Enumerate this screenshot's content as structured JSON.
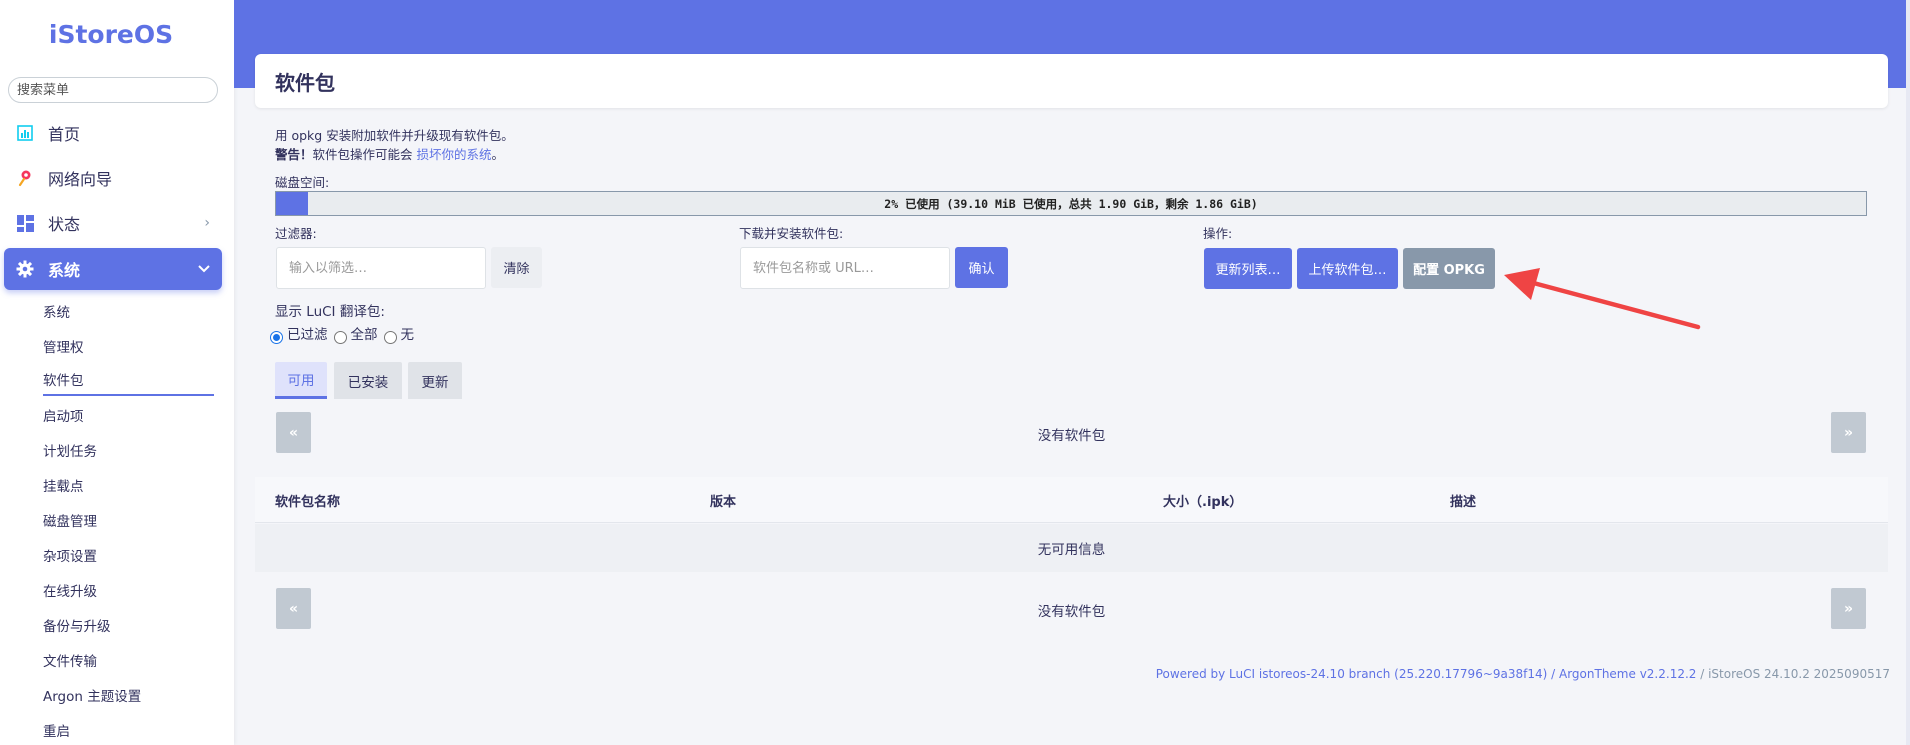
{
  "sidebar": {
    "logo": "iStoreOS",
    "search_placeholder": "搜索菜单",
    "nav": [
      {
        "label": "首页",
        "icon": "dashboard-icon"
      },
      {
        "label": "网络向导",
        "icon": "wizard-icon"
      },
      {
        "label": "状态",
        "icon": "status-icon",
        "chevron": "›"
      },
      {
        "label": "系统",
        "icon": "gear-icon",
        "chevron": "⌄"
      }
    ],
    "subitems": [
      "系统",
      "管理权",
      "软件包",
      "启动项",
      "计划任务",
      "挂载点",
      "磁盘管理",
      "杂项设置",
      "在线升级",
      "备份与升级",
      "文件传输",
      "Argon 主题设置",
      "重启"
    ],
    "current_subitem": "软件包"
  },
  "page": {
    "title": "软件包",
    "desc_line1": "用 opkg 安装附加软件并升级现有软件包。",
    "warning_prefix": "警告！",
    "warning_text": "软件包操作可能会 ",
    "warning_link": "损坏你的系统",
    "warning_suffix": "。",
    "disk_label": "磁盘空间:",
    "disk_text": "2% 已使用 (39.10 MiB 已使用，总共 1.90 GiB，剩余 1.86 GiB)",
    "disk_used_fraction": 0.02
  },
  "filter": {
    "label": "过滤器:",
    "placeholder": "输入以筛选…",
    "clear": "清除"
  },
  "download": {
    "label": "下载并安装软件包:",
    "placeholder": "软件包名称或 URL…",
    "confirm": "确认"
  },
  "actions": {
    "label": "操作:",
    "update_lists": "更新列表…",
    "upload_package": "上传软件包…",
    "configure_opkg": "配置 OPKG"
  },
  "translations": {
    "label": "显示 LuCI 翻译包:",
    "options": [
      "已过滤",
      "全部",
      "无"
    ],
    "selected": "已过滤"
  },
  "tabs": [
    "可用",
    "已安装",
    "更新"
  ],
  "active_tab": "可用",
  "pager": {
    "prev": "«",
    "next": "»",
    "empty_text": "没有软件包"
  },
  "table": {
    "headers": [
      "软件包名称",
      "版本",
      "大小（.ipk）",
      "描述"
    ],
    "empty_text": "无可用信息"
  },
  "footer": {
    "text": "Powered by LuCI istoreos-24.10 branch (25.220.17796~9a38f14) / ArgonTheme v2.2.12.2",
    "version": " / iStoreOS 24.10.2 2025090517"
  },
  "colors": {
    "accent": "#5e72e4",
    "annotation_arrow": "#ef4444"
  }
}
